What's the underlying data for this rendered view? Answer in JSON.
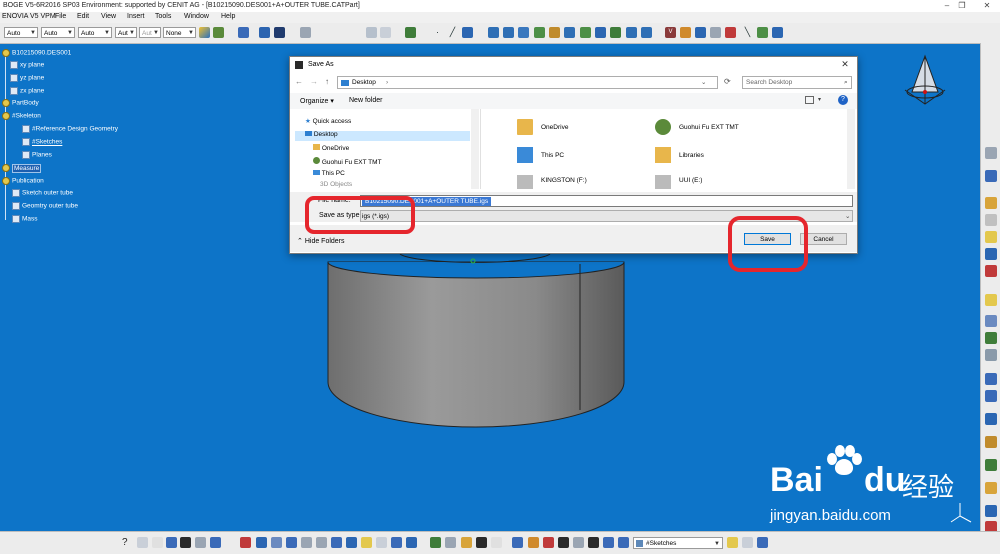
{
  "window": {
    "title": "BOGE V5-6R2016 SP03 Environment: supported by CENIT AG - [B10215090.DES001+A+OUTER TUBE.CATPart]",
    "minimize": "–",
    "restore": "❐",
    "close": "✕"
  },
  "menu": [
    "ENOVIA V5 VPM",
    "File",
    "Edit",
    "View",
    "Insert",
    "Tools",
    "Window",
    "Help"
  ],
  "toolbar": {
    "combos": [
      "Auto",
      "Auto",
      "Auto",
      "Aut",
      "Aut",
      "None"
    ]
  },
  "tree": {
    "root": "B10215090.DES001",
    "items": [
      "xy plane",
      "yz plane",
      "zx plane",
      "PartBody",
      "#Skeleton",
      "#Reference Design Geometry",
      "#Sketches",
      "Planes",
      "Measure",
      "Publication",
      "Sketch outer tube",
      "Geomtry outer tube",
      "Mass"
    ]
  },
  "dialog": {
    "title": "Save As",
    "close": "✕",
    "nav": {
      "back": "←",
      "forward": "→",
      "up": "↑",
      "refresh": "⟳"
    },
    "address": {
      "location": "Desktop",
      "separator": "›"
    },
    "search_placeholder": "Search Desktop",
    "commands": {
      "organize": "Organize",
      "new_folder": "New folder",
      "help": "?"
    },
    "nav_pane": [
      "Quick access",
      "Desktop",
      "OneDrive",
      "Guohui Fu EXT TMT",
      "This PC",
      "3D Objects"
    ],
    "files": [
      "OneDrive",
      "Guohui Fu EXT TMT",
      "This PC",
      "Libraries",
      "KINGSTON (F:)",
      "UUI (E:)"
    ],
    "file_name_label": "File name:",
    "file_name_value": "B10215090.DES001+A+OUTER TUBE.igs",
    "save_as_type_label": "Save as type:",
    "save_as_type_value": "igs (*.igs)",
    "hide_folders": "Hide Folders",
    "save_button": "Save",
    "cancel_button": "Cancel"
  },
  "bottom": {
    "sketch_combo": "#Sketches"
  },
  "watermark": {
    "brand": "Bai",
    "brand2": "du",
    "cn": "经验",
    "url": "jingyan.baidu.com"
  },
  "colors": {
    "viewport": "#0d74c8",
    "highlight": "#e5262d",
    "accent": "#0078d7"
  }
}
